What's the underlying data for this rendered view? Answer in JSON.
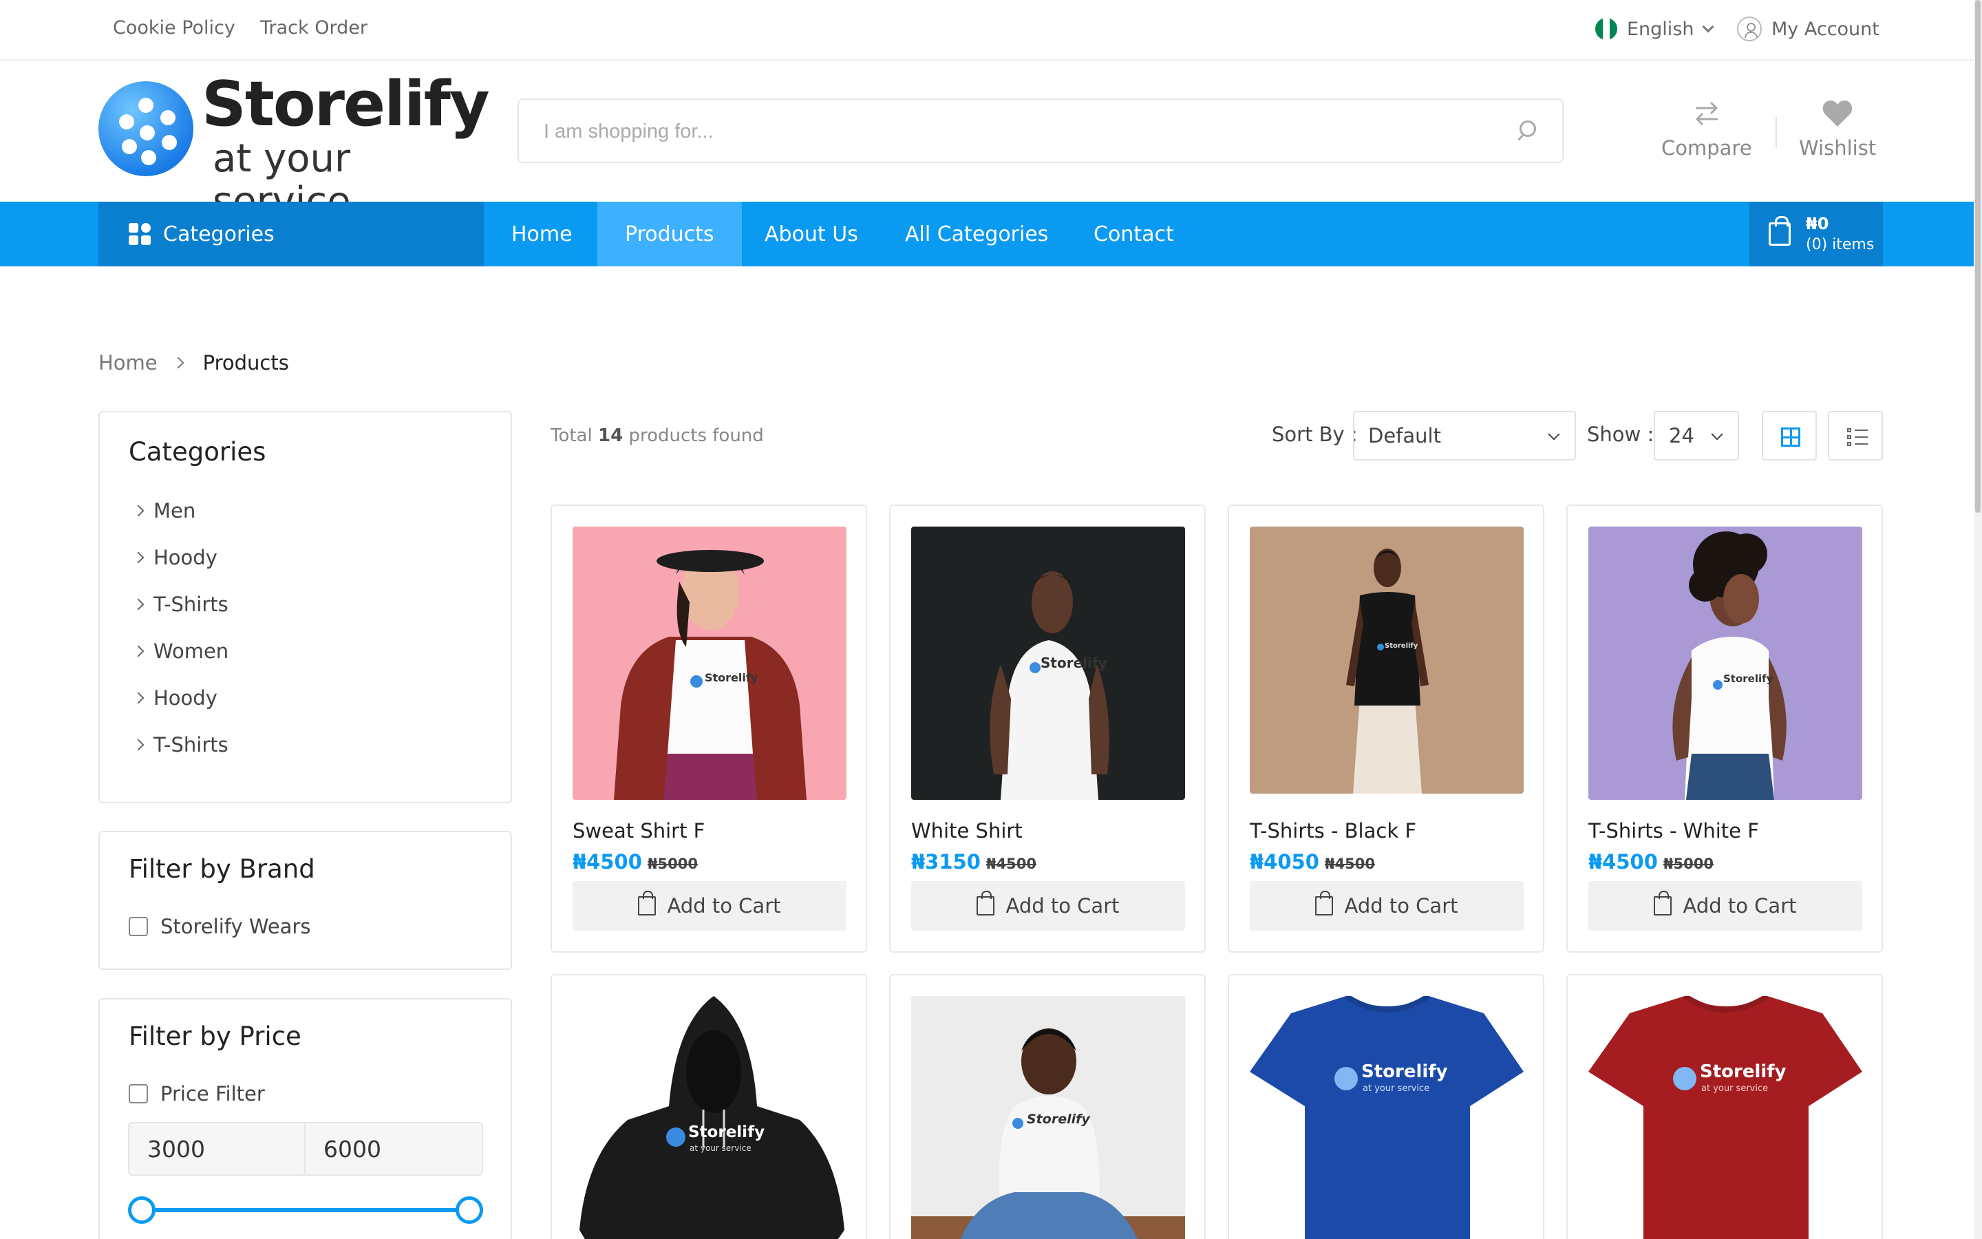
{
  "topbar": {
    "links": [
      "Cookie Policy",
      "Track Order"
    ],
    "language": "English",
    "account": "My Account"
  },
  "brand": {
    "name": "Storelify",
    "tagline": "at your service",
    "color": "#0b9af2"
  },
  "search": {
    "placeholder": "I am shopping for..."
  },
  "header_actions": {
    "compare": "Compare",
    "wishlist": "Wishlist"
  },
  "nav": {
    "categories_label": "Categories",
    "items": [
      "Home",
      "Products",
      "About Us",
      "All Categories",
      "Contact"
    ],
    "active": "Products",
    "cart_total": "₦0",
    "cart_items": "(0) items"
  },
  "breadcrumb": {
    "home": "Home",
    "current": "Products"
  },
  "sidebar": {
    "categories_title": "Categories",
    "categories": [
      "Men",
      "Hoody",
      "T-Shirts",
      "Women",
      "Hoody",
      "T-Shirts"
    ],
    "brand_title": "Filter by Brand",
    "brands": [
      "Storelify Wears"
    ],
    "price_title": "Filter by Price",
    "price_filter_label": "Price Filter",
    "price_min": "3000",
    "price_max": "6000"
  },
  "toolbar": {
    "found_prefix": "Total",
    "found_count": "14",
    "found_suffix": "products found",
    "sort_label": "Sort By :",
    "sort_value": "Default",
    "show_label": "Show :",
    "show_value": "24"
  },
  "cart_button_label": "Add to Cart",
  "products": [
    {
      "name": "Sweat Shirt F",
      "price": "₦4500",
      "old_price": "₦5000"
    },
    {
      "name": "White Shirt",
      "price": "₦3150",
      "old_price": "₦4500"
    },
    {
      "name": "T-Shirts - Black F",
      "price": "₦4050",
      "old_price": "₦4500"
    },
    {
      "name": "T-Shirts - White F",
      "price": "₦4500",
      "old_price": "₦5000"
    }
  ],
  "product_image_text": {
    "brand": "Storelify",
    "tagline": "at your service"
  }
}
